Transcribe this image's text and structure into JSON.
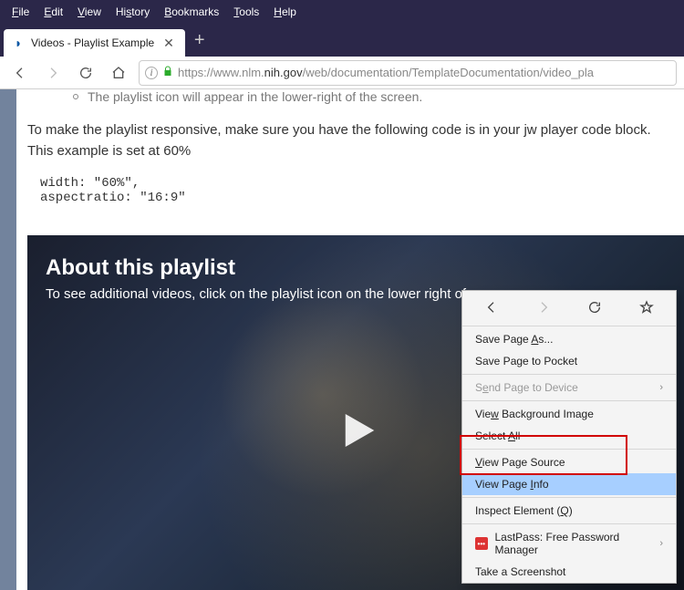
{
  "menubar": [
    "File",
    "Edit",
    "View",
    "History",
    "Bookmarks",
    "Tools",
    "Help"
  ],
  "tab": {
    "title": "Videos - Playlist Example"
  },
  "url": {
    "scheme": "https://",
    "prefix": "www.nlm.",
    "host": "nih.gov",
    "path": "/web/documentation/TemplateDocumentation/video_pla"
  },
  "page": {
    "bullet": "The playlist icon will appear in the lower-right of the screen.",
    "para": "To make the playlist responsive, make sure you have the following code is in your jw player code block. This example is set at 60%",
    "code": "width: \"60%\",\naspectratio: \"16:9\""
  },
  "video": {
    "heading": "About this playlist",
    "subtext": "To see additional videos, click on the playlist icon on the lower right of"
  },
  "ctx": {
    "save_as": "Save Page As...",
    "save_pocket": "Save Page to Pocket",
    "send_device": "Send Page to Device",
    "view_bg": "View Background Image",
    "select_all": "Select All",
    "view_source": "View Page Source",
    "view_info": "View Page Info",
    "inspect": "Inspect Element (Q)",
    "lastpass": "LastPass: Free Password Manager",
    "screenshot": "Take a Screenshot"
  }
}
